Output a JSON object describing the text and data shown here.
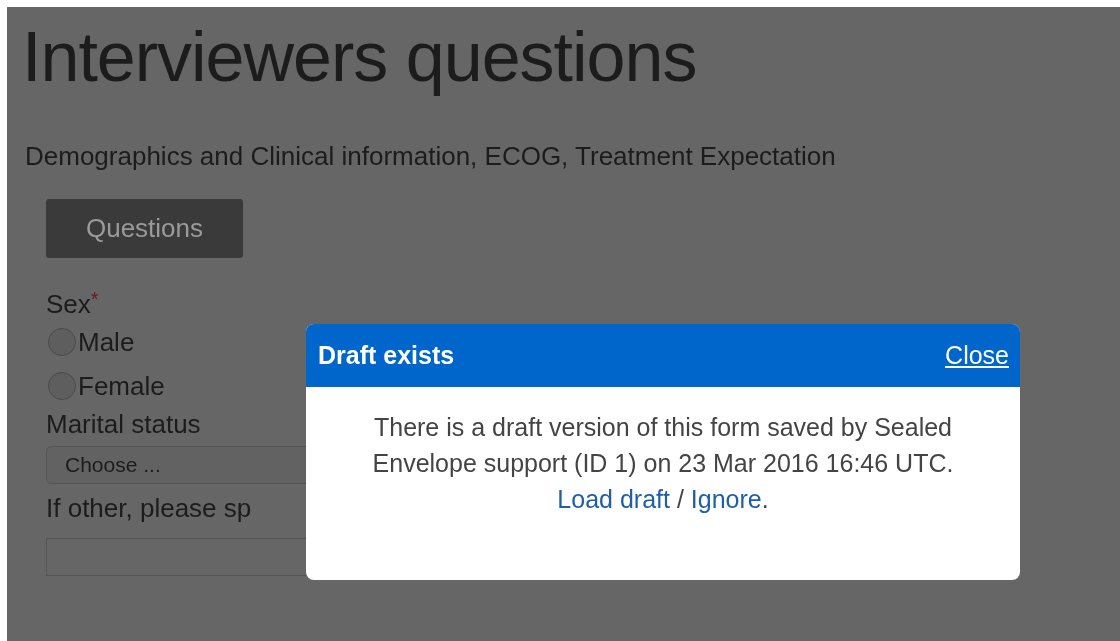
{
  "page": {
    "title": "Interviewers questions",
    "subtitle": "Demographics and Clinical information, ECOG, Treatment Expectation"
  },
  "section_button": "Questions",
  "fields": [
    {
      "kind": "radio",
      "label": "Sex",
      "required_mark": "*",
      "options": [
        {
          "label": "Male",
          "selected": false
        },
        {
          "label": "Female",
          "selected": false
        }
      ]
    },
    {
      "kind": "select",
      "label": "Marital status",
      "value": "Choose ..."
    },
    {
      "kind": "text",
      "label": "If other, please sp"
    }
  ],
  "dialog": {
    "title": "Draft exists",
    "close": "Close",
    "message": [
      {
        "kind": "text",
        "text": "There is a draft version of this form saved by Sealed Envelope support (ID 1) on 23 Mar 2016 16:46 UTC. "
      },
      {
        "kind": "link",
        "text": "Load draft"
      },
      {
        "kind": "text",
        "text": " / "
      },
      {
        "kind": "link",
        "text": "Ignore"
      },
      {
        "kind": "text",
        "text": "."
      }
    ]
  }
}
